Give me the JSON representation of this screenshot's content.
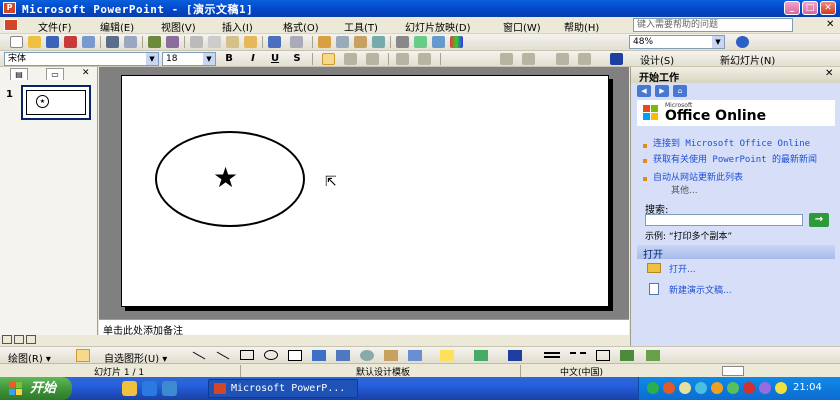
{
  "window": {
    "title": "Microsoft PowerPoint - [演示文稿1]",
    "app_icon": "powerpoint-icon",
    "minimize_glyph": "_",
    "maximize_glyph": "□",
    "close_glyph": "✕"
  },
  "menu": {
    "items": [
      "文件(F)",
      "编辑(E)",
      "视图(V)",
      "插入(I)",
      "格式(O)",
      "工具(T)",
      "幻灯片放映(D)",
      "窗口(W)",
      "帮助(H)"
    ],
    "help_placeholder": "键入需要帮助的问题",
    "close_glyph": "✕"
  },
  "toolbar_standard": {
    "zoom": "48%",
    "dropdown_glyph": "▼"
  },
  "toolbar_formatting": {
    "font": "宋体",
    "size": "18",
    "bold": "B",
    "italic": "I",
    "underline": "U",
    "shadow": "S",
    "design_label": "设计(S)",
    "new_slide_label": "新幻灯片(N)"
  },
  "slides_pane": {
    "slide_number": "1",
    "thumb_star": "★"
  },
  "slide": {
    "star": "★",
    "cursor": "⇱"
  },
  "notes": {
    "placeholder": "单击此处添加备注"
  },
  "task_pane": {
    "title": "开始工作",
    "close_glyph": "✕",
    "nav": [
      "◀",
      "▶",
      "⌂"
    ],
    "logo_small": "Microsoft",
    "logo_text": "Office Online",
    "links": [
      "连接到 Microsoft Office Online",
      "获取有关使用 PowerPoint 的最新新闻",
      "自动从网站更新此列表"
    ],
    "more": "其他...",
    "search_label": "搜索:",
    "go_glyph": "→",
    "example": "示例: “打印多个副本”",
    "open_header": "打开",
    "open_link": "打开...",
    "new_link": "新建演示文稿..."
  },
  "drawing_toolbar": {
    "draw": "绘图(R) ▾",
    "autoshapes": "自选图形(U) ▾"
  },
  "status_bar": {
    "slide": "幻灯片 1 / 1",
    "template": "默认设计模板",
    "language": "中文(中国)"
  },
  "taskbar": {
    "start": "开始",
    "task_label": "Microsoft PowerP...",
    "clock": "21:04"
  }
}
